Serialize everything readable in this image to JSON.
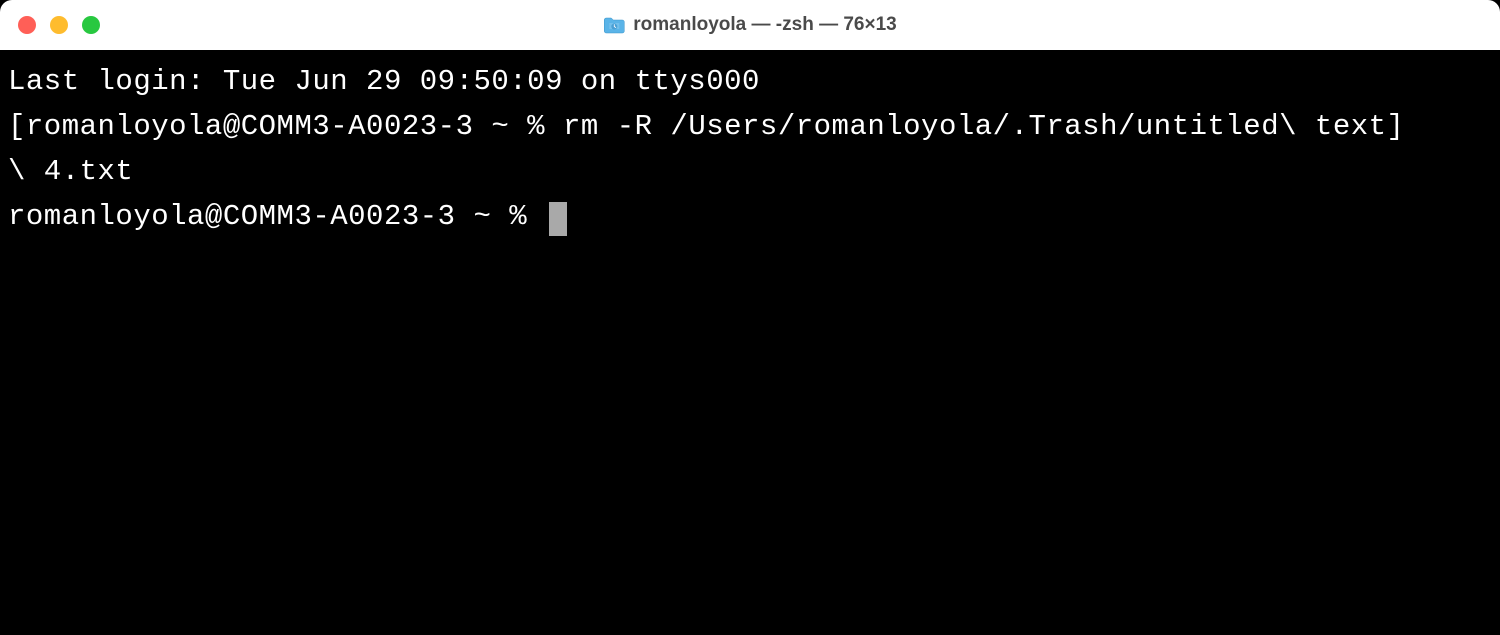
{
  "titlebar": {
    "title": "romanloyola — -zsh — 76×13"
  },
  "terminal": {
    "line1": "Last login: Tue Jun 29 09:50:09 on ttys000",
    "line2_prompt": "[romanloyola@COMM3-A0023-3 ~ % ",
    "line2_cmd": "rm -R /Users/romanloyola/.Trash/untitled\\ text]",
    "line3": "\\ 4.txt",
    "line4_prompt": "romanloyola@COMM3-A0023-3 ~ % "
  }
}
